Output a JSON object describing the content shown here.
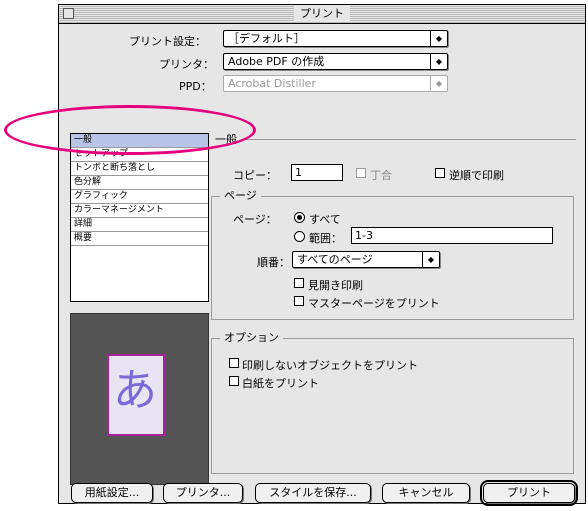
{
  "window": {
    "title": "プリント"
  },
  "top": {
    "print_settings_label": "プリント設定：",
    "print_settings_value": "［デフォルト］",
    "printer_label": "プリンタ：",
    "printer_value": "Adobe PDF の作成",
    "ppd_label": "PPD：",
    "ppd_value": "Acrobat Distiller"
  },
  "sidebar": {
    "items": [
      {
        "label": "一般"
      },
      {
        "label": "セットアップ"
      },
      {
        "label": "トンボと断ち落とし"
      },
      {
        "label": "色分解"
      },
      {
        "label": "グラフィック"
      },
      {
        "label": "カラーマネージメント"
      },
      {
        "label": "詳細"
      },
      {
        "label": "概要"
      }
    ],
    "selected_index": 0
  },
  "preview": {
    "glyph": "あ"
  },
  "general": {
    "heading": "一般",
    "copies_label": "コピー：",
    "copies_value": "1",
    "collate_label": "丁合",
    "reverse_label": "逆順で印刷",
    "pages_group": "ページ",
    "pages_label": "ページ：",
    "all_label": "すべて",
    "range_label": "範囲：",
    "range_value": "1-3",
    "order_label": "順番：",
    "order_value": "すべてのページ",
    "spreads_label": "見開き印刷",
    "master_label": "マスターページをプリント",
    "options_group": "オプション",
    "nonprint_label": "印刷しないオブジェクトをプリント",
    "blank_label": "白紙をプリント"
  },
  "buttons": {
    "page_setup": "用紙設定...",
    "printer": "プリンタ...",
    "save_style": "スタイルを保存...",
    "cancel": "キャンセル",
    "print": "プリント"
  },
  "colors": {
    "highlight": "#e6007e",
    "selection": "#b8c4e8"
  }
}
